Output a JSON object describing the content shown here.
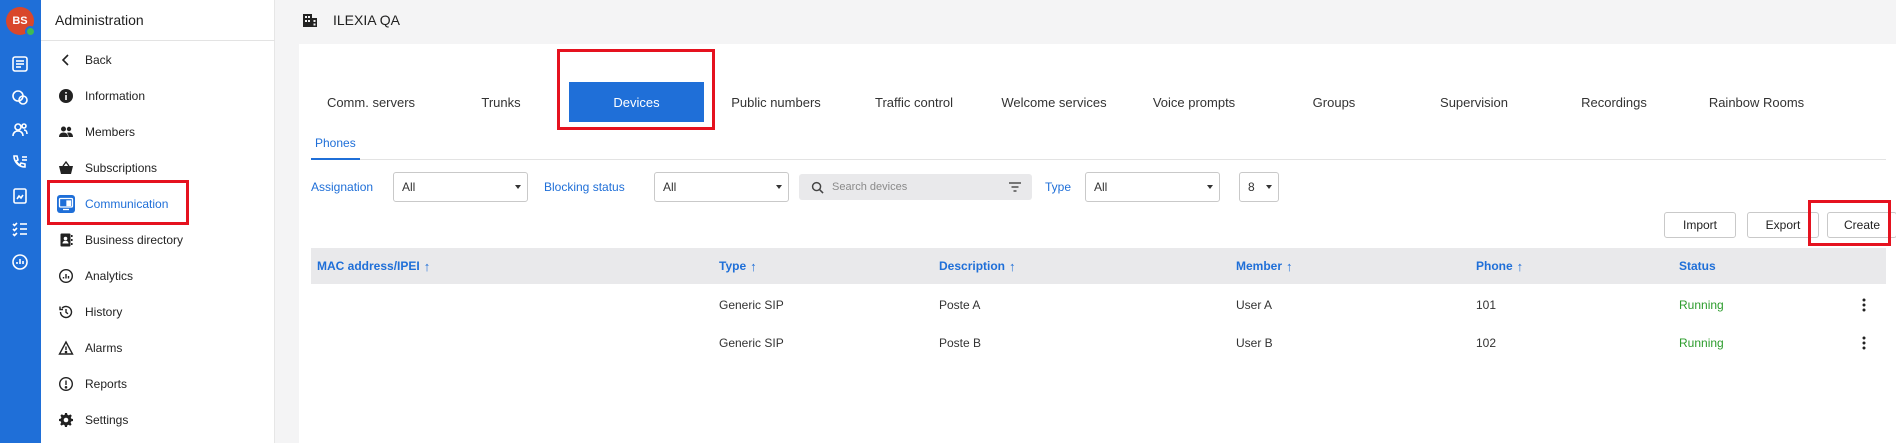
{
  "user": {
    "initials": "BS"
  },
  "sidebar": {
    "title": "Administration",
    "items": [
      {
        "label": "Back",
        "icon": "chevron-left-icon"
      },
      {
        "label": "Information",
        "icon": "info-icon"
      },
      {
        "label": "Members",
        "icon": "people-icon"
      },
      {
        "label": "Subscriptions",
        "icon": "basket-icon"
      },
      {
        "label": "Communication",
        "icon": "monitor-phone-icon",
        "active": true
      },
      {
        "label": "Business directory",
        "icon": "contacts-book-icon"
      },
      {
        "label": "Analytics",
        "icon": "analytics-gauge-icon"
      },
      {
        "label": "History",
        "icon": "history-icon"
      },
      {
        "label": "Alarms",
        "icon": "warning-icon"
      },
      {
        "label": "Reports",
        "icon": "report-alert-icon"
      },
      {
        "label": "Settings",
        "icon": "gear-icon"
      }
    ]
  },
  "header": {
    "org_name": "ILEXIA QA"
  },
  "tabs": [
    {
      "label": "Comm. servers"
    },
    {
      "label": "Trunks"
    },
    {
      "label": "Devices",
      "active": true
    },
    {
      "label": "Public numbers"
    },
    {
      "label": "Traffic control"
    },
    {
      "label": "Welcome services"
    },
    {
      "label": "Voice prompts"
    },
    {
      "label": "Groups"
    },
    {
      "label": "Supervision"
    },
    {
      "label": "Recordings"
    },
    {
      "label": "Rainbow Rooms"
    }
  ],
  "subtabs": [
    {
      "label": "Phones"
    }
  ],
  "filters": {
    "assignation": {
      "label": "Assignation",
      "value": "All"
    },
    "blocking_status": {
      "label": "Blocking status",
      "value": "All"
    },
    "search": {
      "placeholder": "Search devices"
    },
    "type": {
      "label": "Type",
      "value": "All"
    },
    "page_size": {
      "value": "8"
    }
  },
  "actions": {
    "import_label": "Import",
    "export_label": "Export",
    "create_label": "Create"
  },
  "table": {
    "columns": [
      "MAC address/IPEI",
      "Type",
      "Description",
      "Member",
      "Phone",
      "Status"
    ],
    "sort_arrow": "↑",
    "rows": [
      {
        "mac": "",
        "type": "Generic SIP",
        "description": "Poste A",
        "member": "User A",
        "phone": "101",
        "status": "Running"
      },
      {
        "mac": "",
        "type": "Generic SIP",
        "description": "Poste B",
        "member": "User B",
        "phone": "102",
        "status": "Running"
      }
    ]
  },
  "colors": {
    "accent": "#1f6fd8",
    "highlight": "#e5121f",
    "status_running": "#2c9c2c",
    "avatar": "#d9472b"
  }
}
